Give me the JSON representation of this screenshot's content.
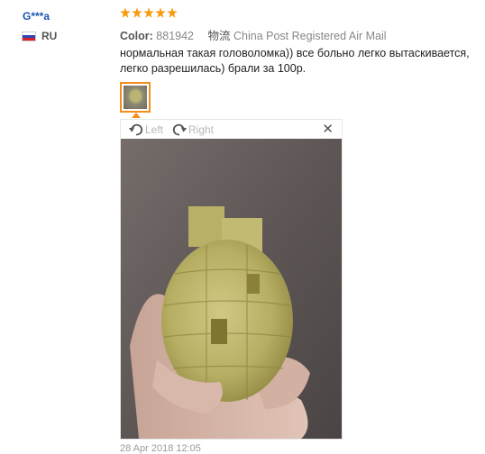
{
  "review": {
    "username": "G***a",
    "country": "RU",
    "rating": 5,
    "color_label": "Color:",
    "color_value": "881942",
    "shipping_label": "物流",
    "shipping_value": "China Post Registered Air Mail",
    "text": "нормальная такая головоломка)) все больно легко вытаскивается, легко разрешилась) брали за 100р.",
    "date": "28 Apr 2018 12:05"
  },
  "viewer": {
    "rotate_left_label": "Left",
    "rotate_right_label": "Right",
    "close_symbol": "✕"
  },
  "colors": {
    "username": "#1a56b4",
    "star": "#f79a0b",
    "thumb_border": "#f28e1c"
  },
  "icons": [
    "russia-flag-icon",
    "star-icon",
    "rotate-left-icon",
    "rotate-right-icon",
    "close-icon"
  ]
}
